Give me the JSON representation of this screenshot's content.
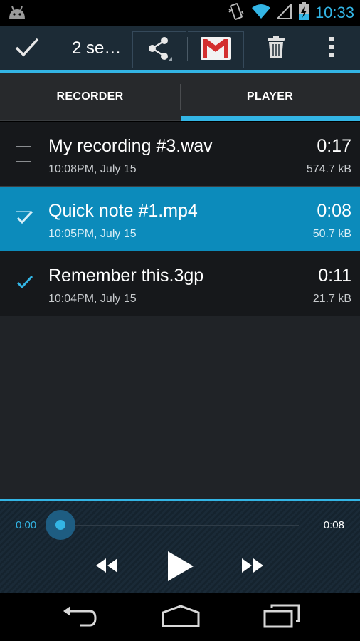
{
  "status_bar": {
    "time": "10:33",
    "icons": [
      "android-icon",
      "vibrate-icon",
      "wifi-icon",
      "signal-icon",
      "battery-charging-icon"
    ]
  },
  "action_bar": {
    "title": "2 se…",
    "actions": [
      "done-check-icon",
      "share-icon",
      "gmail-icon",
      "trash-icon",
      "overflow-menu-icon"
    ]
  },
  "tabs": [
    {
      "label": "RECORDER",
      "selected": false
    },
    {
      "label": "PLAYER",
      "selected": true
    }
  ],
  "recordings": [
    {
      "name": "My recording #3.wav",
      "date": "10:08PM, July 15",
      "duration": "0:17",
      "size": "574.7 kB",
      "checked": false,
      "highlighted": false
    },
    {
      "name": "Quick note #1.mp4",
      "date": "10:05PM, July 15",
      "duration": "0:08",
      "size": "50.7 kB",
      "checked": true,
      "highlighted": true
    },
    {
      "name": "Remember this.3gp",
      "date": "10:04PM, July 15",
      "duration": "0:11",
      "size": "21.7 kB",
      "checked": true,
      "highlighted": false
    }
  ],
  "player": {
    "current_time": "0:00",
    "total_time": "0:08",
    "progress": 0,
    "controls": [
      "rewind-icon",
      "play-icon",
      "fast-forward-icon"
    ]
  },
  "nav_bar": {
    "buttons": [
      "back-icon",
      "home-icon",
      "recents-icon"
    ]
  },
  "colors": {
    "accent": "#33b5e5",
    "selected_row": "#0c8bbb",
    "action_bar": "#1c2b36"
  }
}
